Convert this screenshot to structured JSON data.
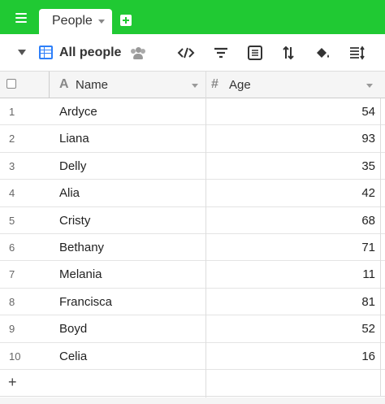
{
  "topbar": {
    "tab_label": "People",
    "menu_icon": "hamburger-menu-icon",
    "add_icon": "add-table-icon",
    "accent": "#20c933"
  },
  "viewbar": {
    "view_name": "All people",
    "view_icon": "grid-view-icon",
    "tools": [
      "embed-icon",
      "filter-icon",
      "group-icon",
      "sort-icon",
      "color-icon",
      "row-height-icon"
    ]
  },
  "columns": [
    {
      "name": "Name",
      "type_icon": "A"
    },
    {
      "name": "Age",
      "type_icon": "#"
    }
  ],
  "rows": [
    {
      "num": "1",
      "name": "Ardyce",
      "age": "54"
    },
    {
      "num": "2",
      "name": "Liana",
      "age": "93"
    },
    {
      "num": "3",
      "name": "Delly",
      "age": "35"
    },
    {
      "num": "4",
      "name": "Alia",
      "age": "42"
    },
    {
      "num": "5",
      "name": "Cristy",
      "age": "68"
    },
    {
      "num": "6",
      "name": "Bethany",
      "age": "71"
    },
    {
      "num": "7",
      "name": "Melania",
      "age": "11"
    },
    {
      "num": "8",
      "name": "Francisca",
      "age": "81"
    },
    {
      "num": "9",
      "name": "Boyd",
      "age": "52"
    },
    {
      "num": "10",
      "name": "Celia",
      "age": "16"
    }
  ],
  "add_row_label": "+"
}
